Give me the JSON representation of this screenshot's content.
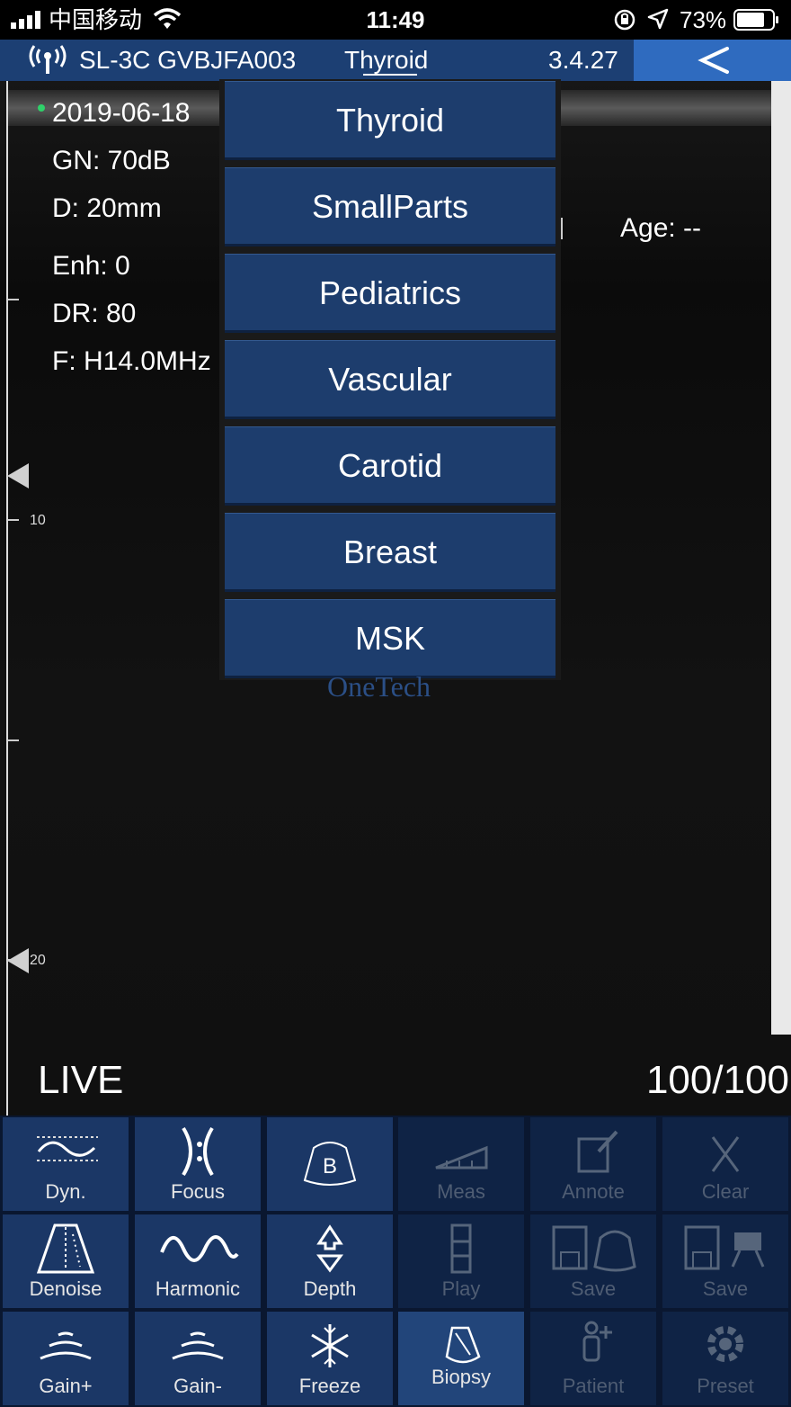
{
  "status_bar": {
    "carrier": "中国移动",
    "time": "11:49",
    "battery": "73%",
    "icons": [
      "signal-icon",
      "wifi-icon",
      "orientation-lock-icon",
      "location-icon",
      "battery-icon"
    ]
  },
  "title_bar": {
    "device": "SL-3C GVBJFA003",
    "preset": "Thyroid",
    "version": "3.4.27",
    "back_icon": "back-chevron-icon"
  },
  "image_params": {
    "date": "2019-06-18",
    "gain": "GN: 70dB",
    "depth": "D: 20mm",
    "enhance": "Enh: 0",
    "dynamic_range": "DR: 80",
    "frequency": "F: H14.0MHz",
    "age": "Age: --"
  },
  "scale": {
    "label_10": "10",
    "label_20": "20"
  },
  "preset_menu": {
    "items": [
      "Thyroid",
      "SmallParts",
      "Pediatrics",
      "Vascular",
      "Carotid",
      "Breast",
      "MSK"
    ]
  },
  "watermark": "OneTech",
  "status": {
    "mode": "LIVE",
    "frames": "100/100"
  },
  "toolbar": {
    "buttons": [
      {
        "label": "Dyn.",
        "icon": "dynamic-range-icon",
        "enabled": true
      },
      {
        "label": "Focus",
        "icon": "focus-icon",
        "enabled": true
      },
      {
        "label": "",
        "icon": "b-mode-icon",
        "enabled": true
      },
      {
        "label": "Meas",
        "icon": "ruler-icon",
        "enabled": false
      },
      {
        "label": "Annote",
        "icon": "annotation-icon",
        "enabled": false
      },
      {
        "label": "Clear",
        "icon": "clear-icon",
        "enabled": false
      },
      {
        "label": "Denoise",
        "icon": "denoise-icon",
        "enabled": true
      },
      {
        "label": "Harmonic",
        "icon": "harmonic-wave-icon",
        "enabled": true
      },
      {
        "label": "Depth",
        "icon": "depth-arrows-icon",
        "enabled": true
      },
      {
        "label": "Play",
        "icon": "film-play-icon",
        "enabled": false
      },
      {
        "label": "Save",
        "icon": "save-image-icon",
        "enabled": false
      },
      {
        "label": "Save",
        "icon": "save-video-icon",
        "enabled": false
      },
      {
        "label": "Gain+",
        "icon": "gain-up-icon",
        "enabled": true
      },
      {
        "label": "Gain-",
        "icon": "gain-down-icon",
        "enabled": true
      },
      {
        "label": "Freeze",
        "icon": "snowflake-icon",
        "enabled": true
      },
      {
        "label": "Biopsy",
        "icon": "biopsy-icon",
        "enabled": true
      },
      {
        "label": "Patient",
        "icon": "patient-icon",
        "enabled": false
      },
      {
        "label": "Preset",
        "icon": "gear-icon",
        "enabled": false
      }
    ]
  }
}
